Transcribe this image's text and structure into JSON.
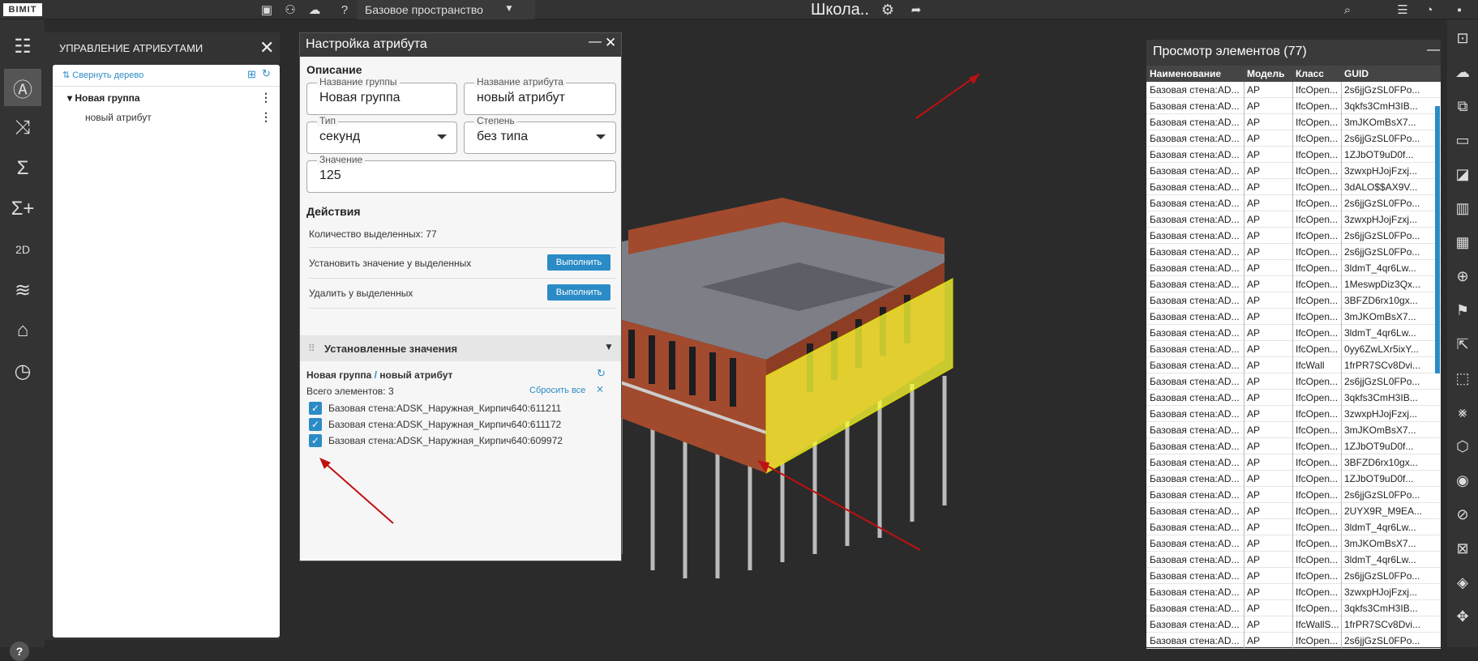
{
  "app": {
    "logo": "BIMIT",
    "workspace": "Базовое пространство",
    "project": "Школа.."
  },
  "attr_panel": {
    "title": "УПРАВЛЕНИЕ АТРИБУТАМИ",
    "collapse": "Свернуть дерево",
    "group": "Новая группа",
    "attr": "новый атрибут"
  },
  "config": {
    "title": "Настройка атрибута",
    "desc": "Описание",
    "group_name": {
      "label": "Название группы",
      "value": "Новая группа"
    },
    "attr_name": {
      "label": "Название атрибута",
      "value": "новый атрибут"
    },
    "type": {
      "label": "Тип",
      "value": "секунд"
    },
    "degree": {
      "label": "Степень",
      "value": "без типа"
    },
    "value": {
      "label": "Значение",
      "value": "125"
    },
    "actions": "Действия",
    "selected_count": "Количество выделенных: 77",
    "set_label": "Установить значение у выделенных",
    "del_label": "Удалить у выделенных",
    "run": "Выполнить",
    "installed": "Установленные значения",
    "path_group": "Новая группа",
    "path_sep": " / ",
    "path_attr": "новый атрибут",
    "total": "Всего элементов: 3",
    "reset": "Сбросить все",
    "items": [
      "Базовая стена:ADSK_Наружная_Кирпич640:611211",
      "Базовая стена:ADSK_Наружная_Кирпич640:611172",
      "Базовая стена:ADSK_Наружная_Кирпич640:609972"
    ]
  },
  "elements": {
    "title": "Просмотр элементов (77)",
    "cols": [
      "Наименование",
      "Модель",
      "Класс",
      "GUID"
    ],
    "rows": [
      [
        "Базовая стена:AD...",
        "АР",
        "IfcOpen...",
        "2s6jjGzSL0FPo..."
      ],
      [
        "Базовая стена:AD...",
        "АР",
        "IfcOpen...",
        "3qkfs3CmH3IB..."
      ],
      [
        "Базовая стена:AD...",
        "АР",
        "IfcOpen...",
        "3mJKOmBsX7..."
      ],
      [
        "Базовая стена:AD...",
        "АР",
        "IfcOpen...",
        "2s6jjGzSL0FPo..."
      ],
      [
        "Базовая стена:AD...",
        "АР",
        "IfcOpen...",
        "1ZJbOT9uD0f..."
      ],
      [
        "Базовая стена:AD...",
        "АР",
        "IfcOpen...",
        "3zwxpHJojFzxj..."
      ],
      [
        "Базовая стена:AD...",
        "АР",
        "IfcOpen...",
        "3dALO$$AX9V..."
      ],
      [
        "Базовая стена:AD...",
        "АР",
        "IfcOpen...",
        "2s6jjGzSL0FPo..."
      ],
      [
        "Базовая стена:AD...",
        "АР",
        "IfcOpen...",
        "3zwxpHJojFzxj..."
      ],
      [
        "Базовая стена:AD...",
        "АР",
        "IfcOpen...",
        "2s6jjGzSL0FPo..."
      ],
      [
        "Базовая стена:AD...",
        "АР",
        "IfcOpen...",
        "2s6jjGzSL0FPo..."
      ],
      [
        "Базовая стена:AD...",
        "АР",
        "IfcOpen...",
        "3ldmT_4qr6Lw..."
      ],
      [
        "Базовая стена:AD...",
        "АР",
        "IfcOpen...",
        "1MeswpDiz3Qx..."
      ],
      [
        "Базовая стена:AD...",
        "АР",
        "IfcOpen...",
        "3BFZD6rx10gx..."
      ],
      [
        "Базовая стена:AD...",
        "АР",
        "IfcOpen...",
        "3mJKOmBsX7..."
      ],
      [
        "Базовая стена:AD...",
        "АР",
        "IfcOpen...",
        "3ldmT_4qr6Lw..."
      ],
      [
        "Базовая стена:AD...",
        "АР",
        "IfcOpen...",
        "0yy6ZwLXr5ixY..."
      ],
      [
        "Базовая стена:AD...",
        "АР",
        "IfcWall",
        "1frPR7SCv8Dvi..."
      ],
      [
        "Базовая стена:AD...",
        "АР",
        "IfcOpen...",
        "2s6jjGzSL0FPo..."
      ],
      [
        "Базовая стена:AD...",
        "АР",
        "IfcOpen...",
        "3qkfs3CmH3IB..."
      ],
      [
        "Базовая стена:AD...",
        "АР",
        "IfcOpen...",
        "3zwxpHJojFzxj..."
      ],
      [
        "Базовая стена:AD...",
        "АР",
        "IfcOpen...",
        "3mJKOmBsX7..."
      ],
      [
        "Базовая стена:AD...",
        "АР",
        "IfcOpen...",
        "1ZJbOT9uD0f..."
      ],
      [
        "Базовая стена:AD...",
        "АР",
        "IfcOpen...",
        "3BFZD6rx10gx..."
      ],
      [
        "Базовая стена:AD...",
        "АР",
        "IfcOpen...",
        "1ZJbOT9uD0f..."
      ],
      [
        "Базовая стена:AD...",
        "АР",
        "IfcOpen...",
        "2s6jjGzSL0FPo..."
      ],
      [
        "Базовая стена:AD...",
        "АР",
        "IfcOpen...",
        "2UYX9R_M9EA..."
      ],
      [
        "Базовая стена:AD...",
        "АР",
        "IfcOpen...",
        "3ldmT_4qr6Lw..."
      ],
      [
        "Базовая стена:AD...",
        "АР",
        "IfcOpen...",
        "3mJKOmBsX7..."
      ],
      [
        "Базовая стена:AD...",
        "АР",
        "IfcOpen...",
        "3ldmT_4qr6Lw..."
      ],
      [
        "Базовая стена:AD...",
        "АР",
        "IfcOpen...",
        "2s6jjGzSL0FPo..."
      ],
      [
        "Базовая стена:AD...",
        "АР",
        "IfcOpen...",
        "3zwxpHJojFzxj..."
      ],
      [
        "Базовая стена:AD...",
        "АР",
        "IfcOpen...",
        "3qkfs3CmH3IB..."
      ],
      [
        "Базовая стена:AD...",
        "АР",
        "IfcWallS...",
        "1frPR7SCv8Dvi..."
      ],
      [
        "Базовая стена:AD...",
        "АР",
        "IfcOpen...",
        "2s6jjGzSL0FPo..."
      ]
    ]
  }
}
